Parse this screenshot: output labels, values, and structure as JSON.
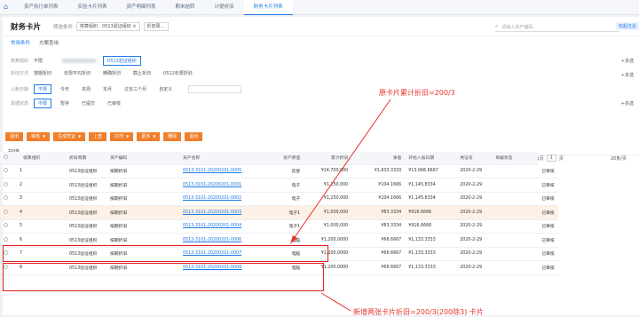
{
  "tabs": [
    "资产执行单列表",
    "实验卡片列表",
    "资产明细列表",
    "期末结转",
    "计提折旧",
    "财务卡片列表"
  ],
  "active_tab": 5,
  "title": "财务卡片",
  "filter_label": "筛选条件",
  "chips": [
    "核算组织：0513验证组织 ×",
    "折旧周…"
  ],
  "search_placeholder": "请输入资产编码",
  "collapse": "收起过滤",
  "quick_tabs": [
    "常用条件",
    "方案查询"
  ],
  "row_org": {
    "label": "核算组织",
    "options": [
      "不限",
      "0513验证组织"
    ]
  },
  "row_type": {
    "label": "折旧方法",
    "options": [
      "按期折旧",
      "年限平均折旧",
      "精确折旧",
      "截止折旧",
      "0512年限折旧"
    ]
  },
  "row_date": {
    "label": "入账日期",
    "options": [
      "不限",
      "今天",
      "本周",
      "本月",
      "过去三个月",
      "自定义"
    ]
  },
  "row_status": {
    "label": "单据状态",
    "options": [
      "不限",
      "暂存",
      "已提交",
      "已审核"
    ]
  },
  "more": "+多选",
  "toolbar": [
    "退出",
    "审核",
    "生成凭证",
    "上查",
    "打印",
    "更多",
    "删除",
    "退出"
  ],
  "list_count": "共8条",
  "pager": {
    "text1": "共1页",
    "page": "1",
    "text2": "页",
    "size": "20条/页"
  },
  "columns": [
    "",
    "核算组织",
    "折旧周期",
    "资产编码",
    "资产名称",
    "资产原值",
    "累计折旧",
    "净值",
    "开始入账日期",
    "凭证号",
    "单据状态"
  ],
  "rows": [
    [
      "1",
      "0513验证组织",
      "按期折旧",
      "0513-3101-20200201-0005",
      "房屋",
      "¥14,700,000",
      "¥1,633.3333",
      "¥13,066.6667",
      "2020-2-29",
      "",
      "已审核"
    ],
    [
      "2",
      "0513验证组织",
      "按期折旧",
      "0513-3101-20200201-0001",
      "电子",
      "¥1,250,000",
      "¥104.1666",
      "¥1,145.8334",
      "2020-2-29",
      "",
      "已审核"
    ],
    [
      "3",
      "0513验证组织",
      "按期折旧",
      "0513-3101-20200201-0002",
      "电子",
      "¥1,250,000",
      "¥104.1666",
      "¥1,145.8334",
      "2020-2-29",
      "",
      "已审核"
    ],
    [
      "4",
      "0513验证组织",
      "按期折旧",
      "0513-3101-20200201-0003",
      "电子1",
      "¥1,000,000",
      "¥83.3334",
      "¥916.6666",
      "2020-2-29",
      "",
      "已审核"
    ],
    [
      "5",
      "0513验证组织",
      "按期折旧",
      "0513-3101-20200201-0004",
      "电子1",
      "¥1,000,000",
      "¥83.3334",
      "¥916.6666",
      "2020-2-29",
      "",
      "已审核"
    ],
    [
      "6",
      "0513验证组织",
      "按期折旧",
      "0513-3101-20200201-0006",
      "电脑",
      "¥1,200,0000",
      "¥66.6667",
      "¥1,133.3333",
      "2020-2-29",
      "",
      "已审核"
    ],
    [
      "7",
      "0513验证组织",
      "按期折旧",
      "0513-3101-20200201-0007",
      "电脑",
      "¥1,200,0000",
      "¥66.6667",
      "¥1,133.3333",
      "2020-2-29",
      "",
      "已审核"
    ],
    [
      "8",
      "0513验证组织",
      "按期折旧",
      "0513-3101-20200201-0008",
      "电脑",
      "¥1,200,0000",
      "¥66.6667",
      "¥1,133.3333",
      "2020-2-29",
      "",
      "已审核"
    ]
  ],
  "annotation_top": "原卡片累计折旧=200/3",
  "annotation_bottom": "新增两张卡片折旧=200/3(200除3) 卡片"
}
